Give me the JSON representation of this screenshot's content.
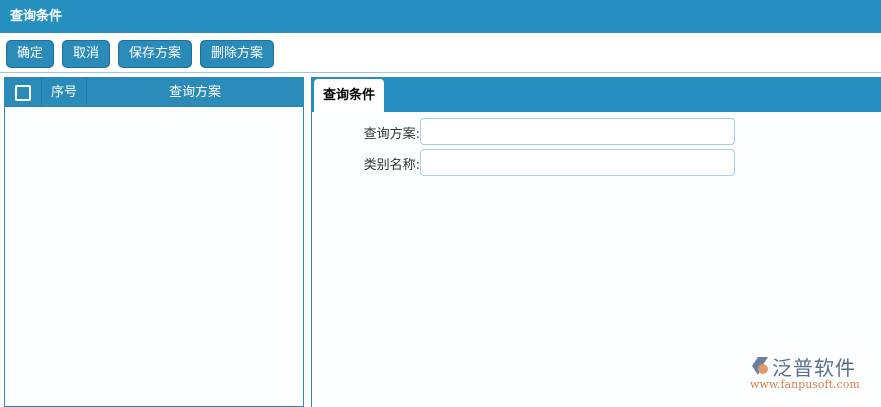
{
  "title": "查询条件",
  "toolbar": {
    "confirm": "确定",
    "cancel": "取消",
    "save": "保存方案",
    "delete": "删除方案"
  },
  "list": {
    "col_index": "序号",
    "col_scheme": "查询方案"
  },
  "tab": "查询条件",
  "form": {
    "scheme_label": "查询方案:",
    "scheme_value": "",
    "category_label": "类别名称:",
    "category_value": ""
  },
  "logo": {
    "name": "泛普软件",
    "url": "www.fanpusoft.com"
  }
}
